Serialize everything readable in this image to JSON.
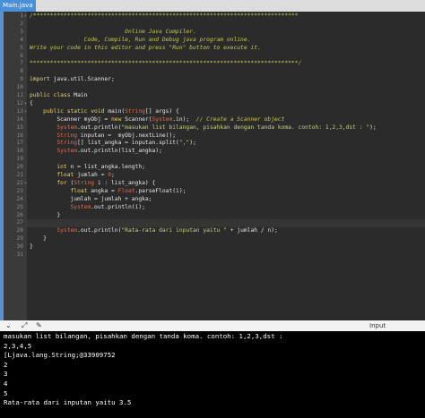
{
  "tab": {
    "label": "Main.java"
  },
  "lines": [
    [
      {
        "c": "cm",
        "t": "/******************************************************************************"
      }
    ],
    [],
    [
      {
        "c": "cm",
        "t": "                            Online Java Compiler."
      }
    ],
    [
      {
        "c": "cm",
        "t": "                Code, Compile, Run and Debug java program online."
      }
    ],
    [
      {
        "c": "cm",
        "t": "Write your code in this editor and press \"Run\" button to execute it."
      }
    ],
    [],
    [
      {
        "c": "cm",
        "t": "*******************************************************************************/"
      }
    ],
    [],
    [
      {
        "c": "kw",
        "t": "import"
      },
      {
        "c": "",
        "t": " java.util.Scanner;"
      }
    ],
    [],
    [
      {
        "c": "kw",
        "t": "public class"
      },
      {
        "c": "",
        "t": " Main"
      }
    ],
    [
      {
        "c": "",
        "t": "{"
      }
    ],
    [
      {
        "c": "",
        "t": "    "
      },
      {
        "c": "kw",
        "t": "public static void"
      },
      {
        "c": "",
        "t": " main("
      },
      {
        "c": "ty",
        "t": "String"
      },
      {
        "c": "",
        "t": "[] args) {"
      }
    ],
    [
      {
        "c": "",
        "t": "        Scanner myObj = "
      },
      {
        "c": "kw",
        "t": "new"
      },
      {
        "c": "",
        "t": " Scanner("
      },
      {
        "c": "sy",
        "t": "System"
      },
      {
        "c": "",
        "t": ".in);  "
      },
      {
        "c": "cm",
        "t": "// Create a Scanner object"
      }
    ],
    [
      {
        "c": "",
        "t": "        "
      },
      {
        "c": "sy",
        "t": "System"
      },
      {
        "c": "",
        "t": ".out.println("
      },
      {
        "c": "st",
        "t": "\"masukan list bilangan, pisahkan dengan tanda koma. contoh: 1,2,3,dst : \""
      },
      {
        "c": "",
        "t": ");"
      }
    ],
    [
      {
        "c": "",
        "t": "        "
      },
      {
        "c": "ty",
        "t": "String"
      },
      {
        "c": "",
        "t": " inputan =  myObj.nextLine();"
      }
    ],
    [
      {
        "c": "",
        "t": "        "
      },
      {
        "c": "ty",
        "t": "String"
      },
      {
        "c": "",
        "t": "[] list_angka = inputan.split("
      },
      {
        "c": "st",
        "t": "\",\""
      },
      {
        "c": "",
        "t": ");"
      }
    ],
    [
      {
        "c": "",
        "t": "        "
      },
      {
        "c": "sy",
        "t": "System"
      },
      {
        "c": "",
        "t": ".out.println(list_angka);"
      }
    ],
    [],
    [
      {
        "c": "",
        "t": "        "
      },
      {
        "c": "kw",
        "t": "int"
      },
      {
        "c": "",
        "t": " n = list_angka.length;"
      }
    ],
    [
      {
        "c": "",
        "t": "        "
      },
      {
        "c": "kw",
        "t": "float"
      },
      {
        "c": "",
        "t": " jumlah = "
      },
      {
        "c": "ty",
        "t": "0"
      },
      {
        "c": "",
        "t": ";"
      }
    ],
    [
      {
        "c": "",
        "t": "        "
      },
      {
        "c": "kw",
        "t": "for"
      },
      {
        "c": "",
        "t": " ("
      },
      {
        "c": "ty",
        "t": "String"
      },
      {
        "c": "",
        "t": " i : list_angka) {"
      }
    ],
    [
      {
        "c": "",
        "t": "            "
      },
      {
        "c": "kw",
        "t": "float"
      },
      {
        "c": "",
        "t": " angka = "
      },
      {
        "c": "ty",
        "t": "Float"
      },
      {
        "c": "",
        "t": ".parseFloat(i);"
      }
    ],
    [
      {
        "c": "",
        "t": "            jumlah = jumlah + angka;"
      }
    ],
    [
      {
        "c": "",
        "t": "            "
      },
      {
        "c": "sy",
        "t": "System"
      },
      {
        "c": "",
        "t": ".out.println(i);"
      }
    ],
    [
      {
        "c": "",
        "t": "        }"
      }
    ],
    [],
    [
      {
        "c": "",
        "t": "        "
      },
      {
        "c": "sy",
        "t": "System"
      },
      {
        "c": "",
        "t": ".out.println("
      },
      {
        "c": "st",
        "t": "\"Rata-rata dari inputan yaitu \""
      },
      {
        "c": "",
        "t": " + jumlah / n);"
      }
    ],
    [
      {
        "c": "",
        "t": "    }"
      }
    ],
    [
      {
        "c": "",
        "t": "}"
      }
    ],
    []
  ],
  "fold_lines": [
    1,
    12,
    13,
    22
  ],
  "current_line": 27,
  "toolbar": {
    "input_label": "Input"
  },
  "console": [
    "masukan list bilangan, pisahkan dengan tanda koma. contoh: 1,2,3,dst :",
    "2,3,4,5",
    "[Ljava.lang.String;@33909752",
    "2",
    "3",
    "4",
    "5",
    "Rata-rata dari inputan yaitu 3.5"
  ]
}
